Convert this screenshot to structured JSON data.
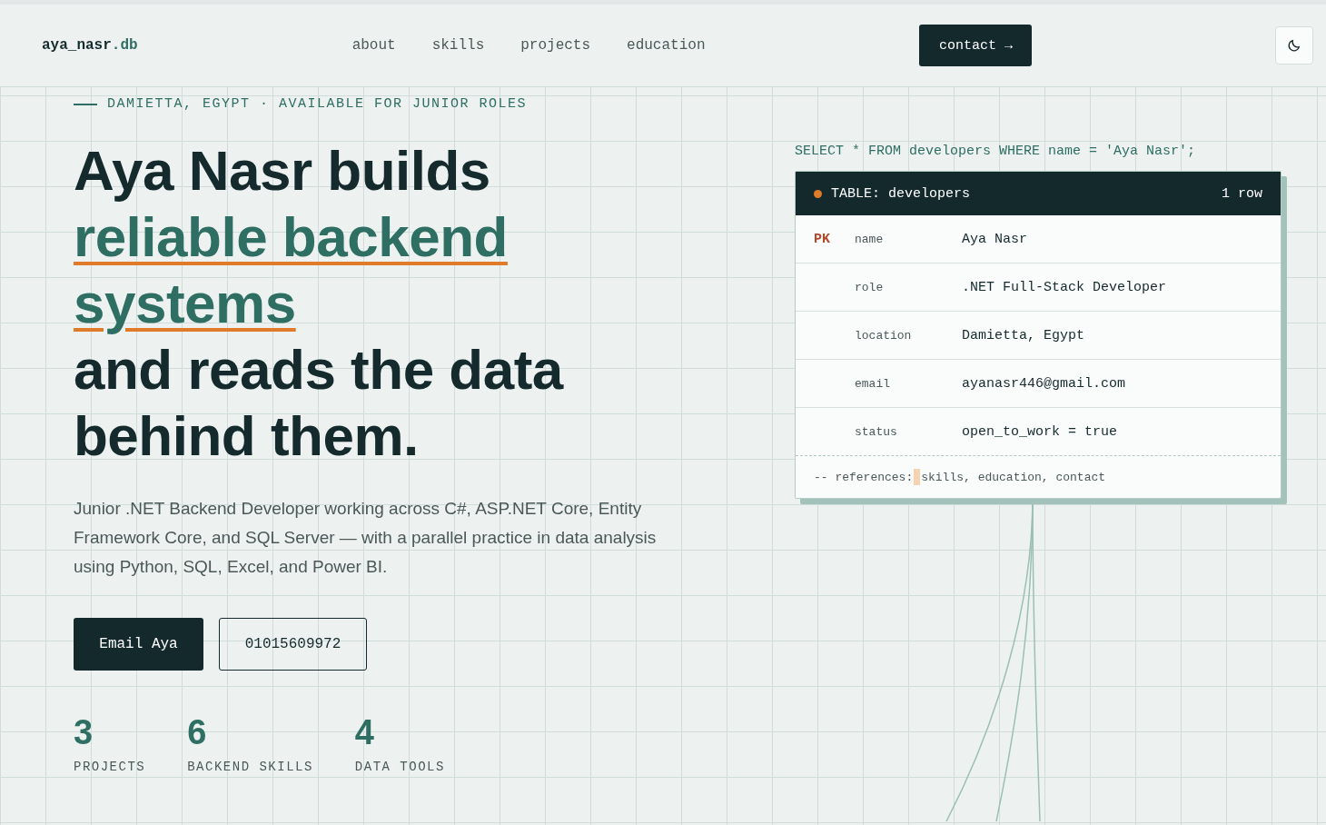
{
  "nav": {
    "logo": {
      "name": "aya_nasr",
      "suffix": ".db"
    },
    "links": [
      "about",
      "skills",
      "projects",
      "education"
    ],
    "cta": "contact →"
  },
  "hero": {
    "eyebrow": "DAMIETTA, EGYPT · AVAILABLE FOR JUNIOR ROLES",
    "headline": {
      "before": "Aya Nasr builds",
      "highlight": "reliable backend systems",
      "after": "and reads the data behind them."
    },
    "intro": "Junior .NET Backend Developer working across C#, ASP.NET Core, Entity Framework Core, and SQL Server — with a parallel practice in data analysis using Python, SQL, Excel, and Power BI.",
    "buttons": [
      {
        "label": "Email Aya",
        "kind": "primary"
      },
      {
        "label": "01015609972",
        "kind": "outline"
      }
    ],
    "stats": [
      {
        "value": "3",
        "label": "PROJECTS"
      },
      {
        "value": "6",
        "label": "BACKEND SKILLS"
      },
      {
        "value": "4",
        "label": "DATA TOOLS"
      }
    ]
  },
  "query": "SELECT * FROM developers WHERE name = 'Aya Nasr';",
  "table": {
    "title": "TABLE: developers",
    "count": "1 row",
    "rows": [
      {
        "key": "PK",
        "field": "name",
        "value": "Aya Nasr"
      },
      {
        "field": "role",
        "value": ".NET Full-Stack Developer"
      },
      {
        "field": "location",
        "value": "Damietta, Egypt"
      },
      {
        "field": "email",
        "value": "ayanasr446@gmail.com"
      },
      {
        "field": "status",
        "value": "open_to_work = true"
      }
    ],
    "footer": {
      "label": "-- references:",
      "refs": "skills, education, contact"
    }
  }
}
